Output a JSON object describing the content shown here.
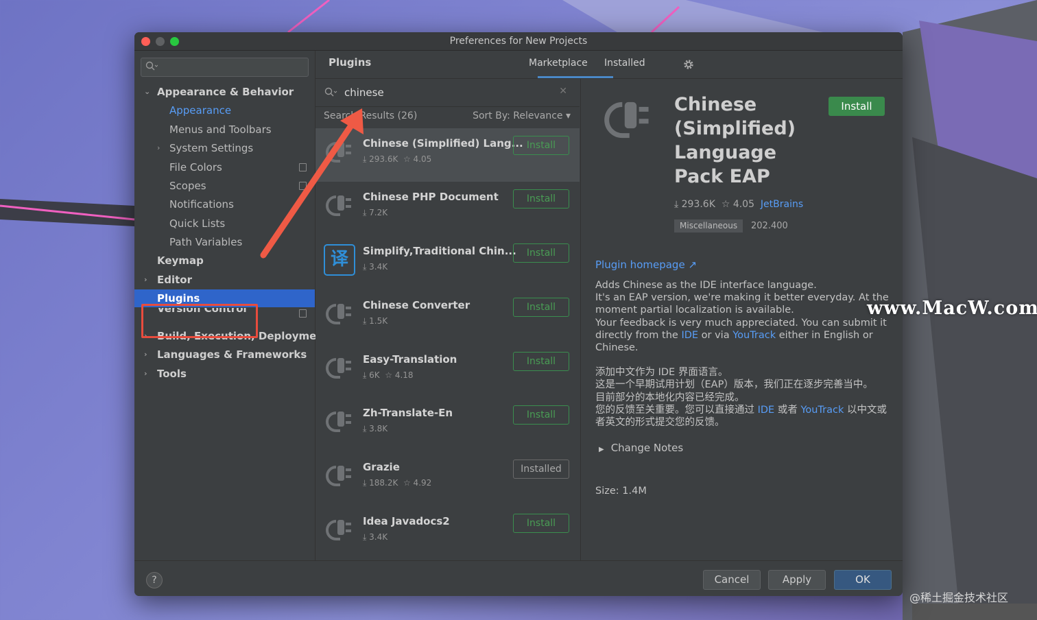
{
  "window": {
    "title": "Preferences for New Projects"
  },
  "sidebar": {
    "search_placeholder": "",
    "items": [
      {
        "label": "Appearance & Behavior",
        "arrow": "⌄"
      },
      {
        "label": "Appearance"
      },
      {
        "label": "Menus and Toolbars"
      },
      {
        "label": "System Settings",
        "arrow": "›"
      },
      {
        "label": "File Colors"
      },
      {
        "label": "Scopes"
      },
      {
        "label": "Notifications"
      },
      {
        "label": "Quick Lists"
      },
      {
        "label": "Path Variables"
      },
      {
        "label": "Keymap"
      },
      {
        "label": "Editor",
        "arrow": "›"
      },
      {
        "label": "Plugins"
      },
      {
        "label": "Version Control"
      },
      {
        "label": "Build, Execution, Deployment",
        "arrow": "›"
      },
      {
        "label": "Languages & Frameworks",
        "arrow": "›"
      },
      {
        "label": "Tools",
        "arrow": "›"
      }
    ]
  },
  "header": {
    "title": "Plugins",
    "tabs": [
      "Marketplace",
      "Installed"
    ]
  },
  "search": {
    "value": "chinese",
    "results": "Search Results (26)",
    "sort": "Sort By: Relevance ▾"
  },
  "plugins": [
    {
      "name": "Chinese (Simplified) Lang...",
      "downloads": "⤓ 293.6K",
      "rating": "☆ 4.05",
      "button": "Install"
    },
    {
      "name": "Chinese PHP Document",
      "downloads": "⤓ 7.2K",
      "rating": "",
      "button": "Install"
    },
    {
      "name": "Simplify,Traditional Chin...",
      "downloads": "⤓ 3.4K",
      "rating": "",
      "button": "Install",
      "icon_text": "译"
    },
    {
      "name": "Chinese Converter",
      "downloads": "⤓ 1.5K",
      "rating": "",
      "button": "Install"
    },
    {
      "name": "Easy-Translation",
      "downloads": "⤓ 6K",
      "rating": "☆ 4.18",
      "button": "Install"
    },
    {
      "name": "Zh-Translate-En",
      "downloads": "⤓ 3.8K",
      "rating": "",
      "button": "Install"
    },
    {
      "name": "Grazie",
      "downloads": "⤓ 188.2K",
      "rating": "☆ 4.92",
      "button": "Installed"
    },
    {
      "name": "Idea Javadocs2",
      "downloads": "⤓ 3.4K",
      "rating": "",
      "button": "Install"
    }
  ],
  "detail": {
    "name": "Chinese (Simplified) Language Pack EAP",
    "install": "Install",
    "downloads": "⤓ 293.6K",
    "rating": "☆ 4.05",
    "vendor": "JetBrains",
    "tag": "Miscellaneous",
    "version": "202.400",
    "homepage": "Plugin homepage ↗",
    "desc1": "Adds Chinese as the IDE interface language.",
    "desc2": "It's an EAP version, we're making it better everyday. At the moment partial localization is available.",
    "desc3a": "Your feedback is very much appreciated. You can submit it directly from the ",
    "desc3_link1": "IDE",
    "desc3b": " or via ",
    "desc3_link2": "YouTrack",
    "desc3c": " either in English or Chinese.",
    "zh1": "添加中文作为 IDE 界面语言。",
    "zh2": "这是一个早期试用计划（EAP）版本，我们正在逐步完善当中。",
    "zh3": "目前部分的本地化内容已经完成。",
    "zh4a": "您的反馈至关重要。您可以直接通过 ",
    "zh4_link1": "IDE",
    "zh4b": " 或者 ",
    "zh4_link2": "YouTrack",
    "zh4c": " 以中文或者英文的形式提交您的反馈。",
    "changes": "Change Notes",
    "size": "Size: 1.4M"
  },
  "footer": {
    "help": "?",
    "cancel": "Cancel",
    "apply": "Apply",
    "ok": "OK"
  },
  "watermark": "www.MacW.com",
  "credit": "@稀土掘金技术社区",
  "colors": {
    "accent": "#2f65ca",
    "install_green": "#3a8a4c",
    "link": "#589df6",
    "highlight_red": "#e84c3d"
  }
}
